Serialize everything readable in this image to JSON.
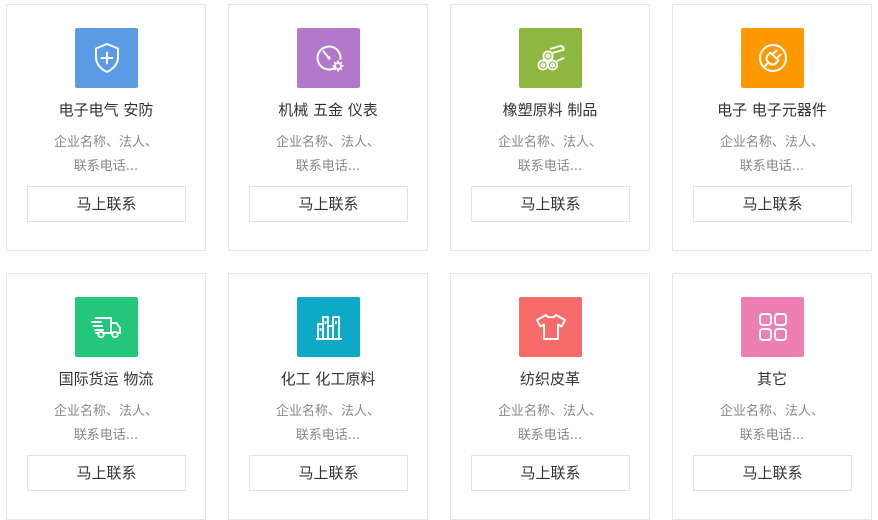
{
  "common": {
    "desc_line1": "企业名称、法人、",
    "desc_line2": "联系电话...",
    "button_label": "马上联系"
  },
  "categories": [
    {
      "title": "电子电气 安防",
      "icon": "shield-plus-icon",
      "color": "#5b9be6"
    },
    {
      "title": "机械 五金 仪表",
      "icon": "gauge-gear-icon",
      "color": "#b278cc"
    },
    {
      "title": "橡塑原料 制品",
      "icon": "rolls-icon",
      "color": "#8db73f"
    },
    {
      "title": "电子 电子元器件",
      "icon": "plug-icon",
      "color": "#ff9900"
    },
    {
      "title": "国际货运 物流",
      "icon": "truck-icon",
      "color": "#22c77a"
    },
    {
      "title": "化工 化工原料",
      "icon": "factory-icon",
      "color": "#0ea9c7"
    },
    {
      "title": "纺织皮革",
      "icon": "shirt-icon",
      "color": "#f76b6b"
    },
    {
      "title": "其它",
      "icon": "grid-icon",
      "color": "#ee7fb3"
    }
  ]
}
